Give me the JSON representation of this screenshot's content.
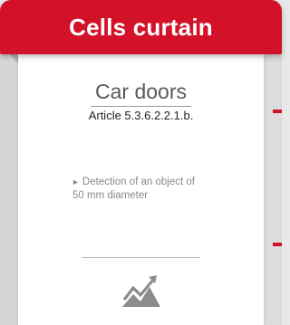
{
  "header": {
    "title": "Cells curtain"
  },
  "card": {
    "subtitle": "Car doors",
    "article": "Article 5.3.6.2.2.1.b.",
    "bullet_marker": "►",
    "bullet_line1": "Detection of an object of",
    "bullet_line2": "50 mm diameter",
    "icon": "trend-chart-icon"
  },
  "colors": {
    "accent": "#d3122a",
    "header_text": "#ffffff",
    "subtitle_text": "#5a5a5a",
    "bullet_text": "#8a8a8a",
    "icon": "#8c8c8c"
  }
}
